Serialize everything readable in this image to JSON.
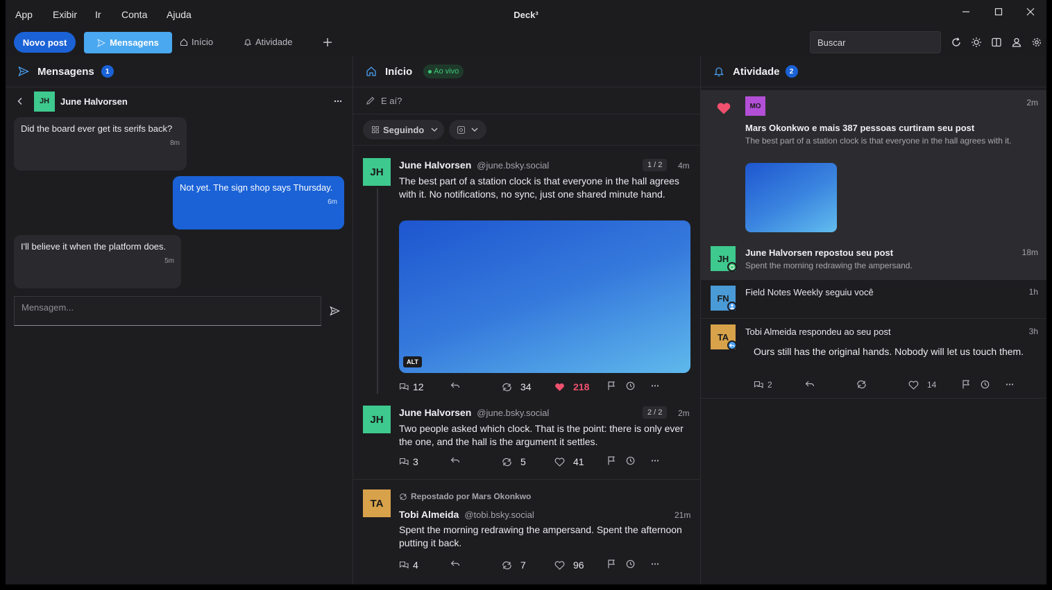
{
  "window": {
    "title": "Deck³",
    "menu": [
      "App",
      "Exibir",
      "Ir",
      "Conta",
      "Ajuda"
    ]
  },
  "toolbar": {
    "new_post": "Novo post",
    "tabs": [
      "Mensagens",
      "Início",
      "Atividade"
    ],
    "search_placeholder": "Buscar"
  },
  "colors": {
    "accent": "#1a62d6",
    "active_tab": "#4aa8f0",
    "like": "#f0506e",
    "live": "#3fc97a"
  },
  "messages": {
    "title": "Mensagens",
    "badge": "1",
    "contact": {
      "initials": "JH",
      "name": "June Halvorsen"
    },
    "thread": [
      {
        "text": "Did the board ever get its serifs back?",
        "time": "8m",
        "from": "them"
      },
      {
        "text": "Not yet. The sign shop says Thursday.",
        "time": "6m",
        "from": "me"
      },
      {
        "text": "I'll believe it when the platform does.",
        "time": "5m",
        "from": "them"
      }
    ],
    "input_placeholder": "Mensagem..."
  },
  "home": {
    "title": "Início",
    "live": "Ao vivo",
    "compose_placeholder": "E aí?",
    "filter": "Seguindo",
    "posts": [
      {
        "initials": "JH",
        "name": "June Halvorsen",
        "handle": "@june.bsky.social",
        "thread": "1 / 2",
        "time": "4m",
        "text": "The best part of a station clock is that everyone in the hall agrees with it. No notifications, no sync, just one shared minute hand.",
        "alt": "ALT",
        "replies": "12",
        "reposts": "34",
        "likes": "218"
      },
      {
        "initials": "JH",
        "name": "June Halvorsen",
        "handle": "@june.bsky.social",
        "thread": "2 / 2",
        "time": "2m",
        "text": "Two people asked which clock. That is the point: there is only ever the one, and the hall is the argument it settles.",
        "replies": "3",
        "reposts": "5",
        "likes": "41"
      },
      {
        "repost_note": "Repostado por Mars Okonkwo",
        "initials": "TA",
        "name": "Tobi Almeida",
        "handle": "@tobi.bsky.social",
        "time": "21m",
        "text": "Spent the morning redrawing the ampersand. Spent the afternoon putting it back.",
        "replies": "4",
        "reposts": "7",
        "likes": "96"
      }
    ]
  },
  "activity": {
    "title": "Atividade",
    "badge": "2",
    "items": [
      {
        "initials": "MO",
        "title": "Mars Okonkwo e mais 387 pessoas curtiram seu post",
        "sub": "The best part of a station clock is that everyone in the hall agrees with it.",
        "time": "2m"
      },
      {
        "initials": "JH",
        "title": "June Halvorsen repostou seu post",
        "sub": "Spent the morning redrawing the ampersand.",
        "time": "18m"
      },
      {
        "initials": "FN",
        "title": "Field Notes Weekly seguiu você",
        "time": "1h"
      },
      {
        "initials": "TA",
        "title": "Tobi Almeida respondeu ao seu post",
        "sub": "Ours still has the original hands. Nobody will let us touch them.",
        "time": "3h",
        "replies": "2",
        "likes": "14"
      }
    ]
  }
}
